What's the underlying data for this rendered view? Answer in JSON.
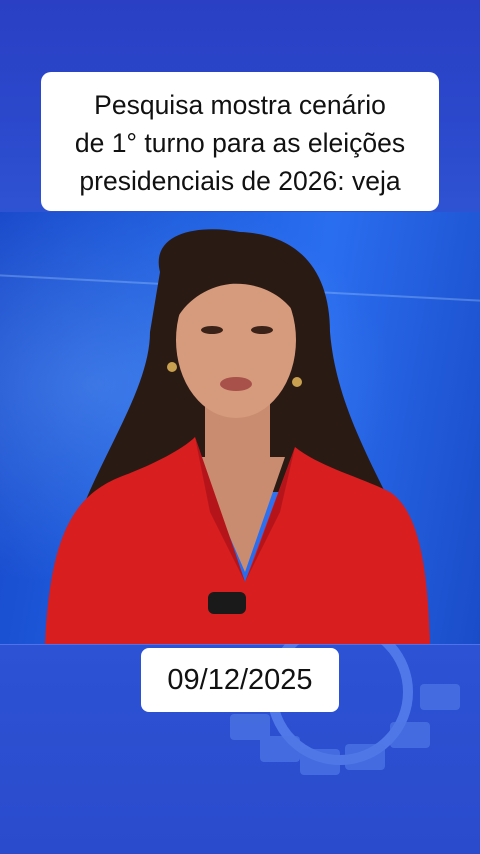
{
  "caption": {
    "lines": [
      "Pesquisa mostra cenário",
      "de 1° turno para as eleições",
      "presidenciais de 2026: veja"
    ]
  },
  "date_label": "09/12/2025",
  "colors": {
    "background_blue": "#2b49cc",
    "studio_blue": "#1f5fe0",
    "blazer_red": "#d81e1e",
    "caption_bg": "#ffffff",
    "caption_text": "#111111"
  }
}
